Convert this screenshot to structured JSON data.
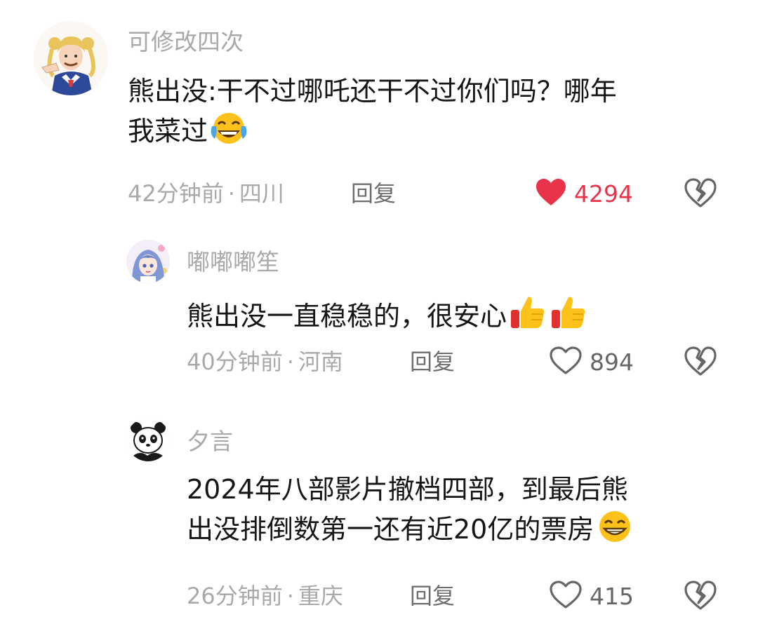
{
  "comments": [
    {
      "username": "可修改四次",
      "line1": "熊出没:干不过哪吒还干不过你们吗？哪年",
      "line2": "我菜过",
      "emoji_name": "laugh-crying-icon",
      "time": "42分钟前",
      "location": "四川",
      "reply_label": "回复",
      "likes": "4294",
      "liked": true
    },
    {
      "username": "嘟嘟嘟笙",
      "line1": "熊出没一直稳稳的，很安心",
      "emoji_name": "thumbs-up-icon",
      "time": "40分钟前",
      "location": "河南",
      "reply_label": "回复",
      "likes": "894",
      "liked": false
    },
    {
      "username": "夕言",
      "line1": "2024年八部影片撤档四部，到最后熊",
      "line2": "出没排倒数第一还有近20亿的票房",
      "emoji_name": "grinning-squint-icon",
      "time": "26分钟前",
      "location": "重庆",
      "reply_label": "回复",
      "likes": "415",
      "liked": false
    }
  ],
  "colors": {
    "like_active": "#e8334a",
    "meta": "#a9a9a9"
  },
  "separator": "·"
}
